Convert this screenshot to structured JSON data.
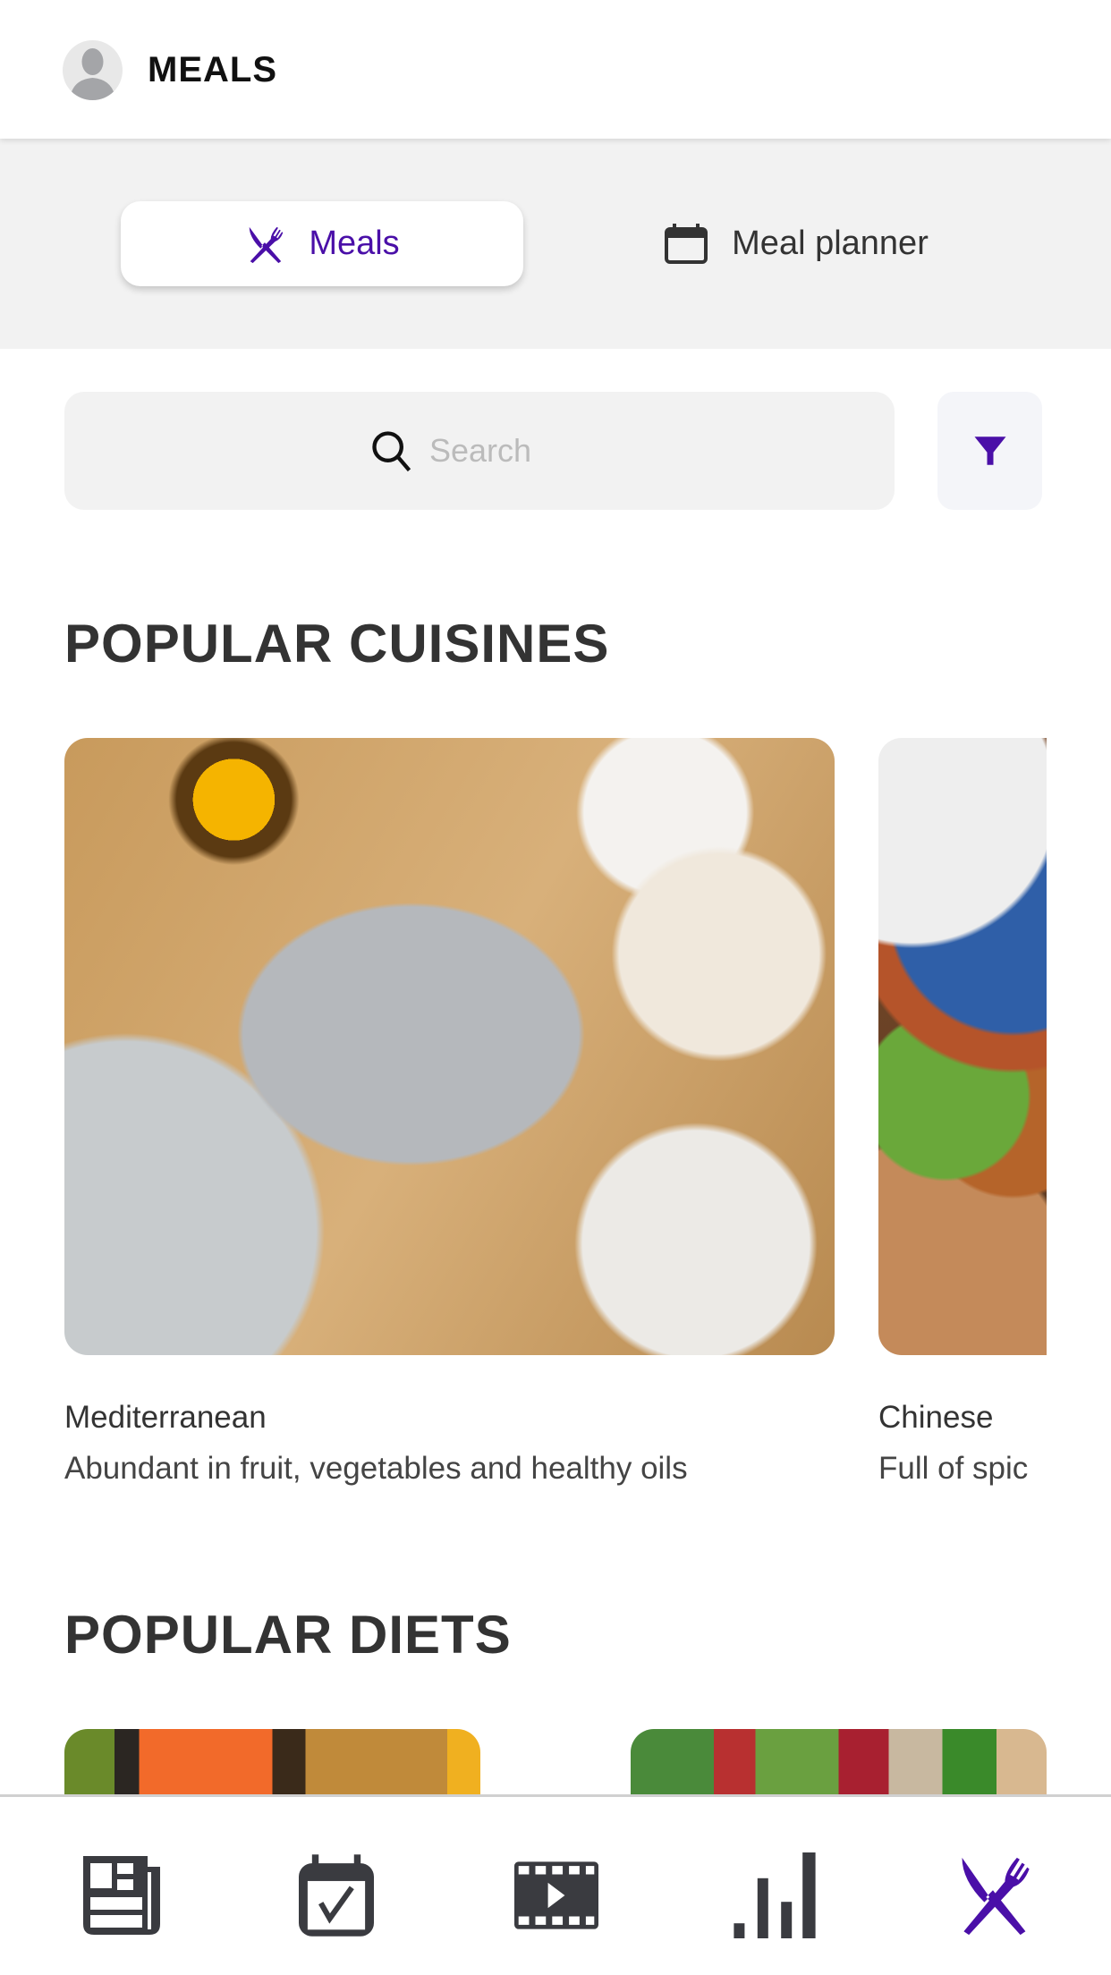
{
  "header": {
    "title": "MEALS"
  },
  "tabs": [
    {
      "label": "Meals",
      "icon": "cutlery-icon",
      "active": true
    },
    {
      "label": "Meal planner",
      "icon": "calendar-icon",
      "active": false
    }
  ],
  "search": {
    "placeholder": "Search"
  },
  "filter": {
    "icon": "filter-icon"
  },
  "sections": {
    "cuisines": {
      "title": "POPULAR CUISINES",
      "items": [
        {
          "name": "Mediterranean",
          "description": "Abundant in fruit, vegetables and healthy oils"
        },
        {
          "name": "Chinese",
          "description": "Full of spic"
        }
      ]
    },
    "diets": {
      "title": "POPULAR DIETS"
    }
  },
  "nav": {
    "items": [
      "newspaper-icon",
      "calendar-check-icon",
      "film-play-icon",
      "bar-chart-icon",
      "cutlery-icon"
    ],
    "active": 4
  },
  "colors": {
    "accent": "#4a0fa8",
    "icon": "#3a3b40",
    "segment_bg": "#f2f2f2"
  }
}
